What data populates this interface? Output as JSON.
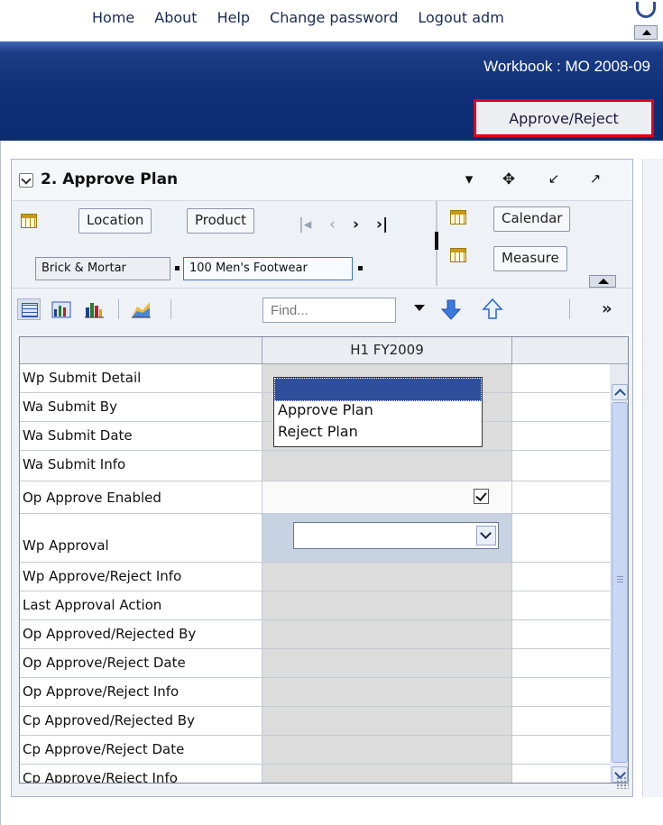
{
  "topnav": {
    "links": [
      {
        "label": "Home",
        "name": "nav-home"
      },
      {
        "label": "About",
        "name": "nav-about"
      },
      {
        "label": "Help",
        "name": "nav-help"
      },
      {
        "label": "Change password",
        "name": "nav-change-password"
      },
      {
        "label": "Logout adm",
        "name": "nav-logout"
      }
    ]
  },
  "header": {
    "workbook_title": "Workbook : MO 2008-09",
    "approve_reject_label": "Approve/Reject",
    "highlight_color": "#e3001b"
  },
  "panel": {
    "title": "2. Approve Plan",
    "icons": [
      "dropdown-icon",
      "move-icon",
      "minimize-icon",
      "maximize-icon"
    ]
  },
  "dimensions": {
    "left_buttons": [
      "Location",
      "Product"
    ],
    "right_buttons": [
      "Calendar",
      "Measure"
    ],
    "filters": [
      "Brick & Mortar",
      "100 Men's Footwear"
    ],
    "nav_arrows": [
      "first-icon",
      "prev-icon",
      "next-icon",
      "last-icon"
    ]
  },
  "toolbar": {
    "find_placeholder": "Find...",
    "icons": [
      "grid-view-icon",
      "chart-grid-icon",
      "bar-chart-icon",
      "area-chart-icon",
      "move-down-icon",
      "move-up-icon",
      "more-icon"
    ]
  },
  "grid": {
    "column_header": "H1 FY2009",
    "rows": [
      {
        "label": "Wp Submit Detail"
      },
      {
        "label": "Wa Submit By"
      },
      {
        "label": "Wa Submit Date"
      },
      {
        "label": "Wa Submit Info"
      },
      {
        "label": "Op Approve Enabled",
        "checked": true
      },
      {
        "label": "Wp Approval",
        "value": ""
      },
      {
        "label": "Wp Approve/Reject Info"
      },
      {
        "label": "Last Approval Action"
      },
      {
        "label": "Op Approved/Rejected By"
      },
      {
        "label": "Op Approve/Reject Date"
      },
      {
        "label": "Op Approve/Reject Info"
      },
      {
        "label": "Cp Approved/Rejected By"
      },
      {
        "label": "Cp Approve/Reject Date"
      },
      {
        "label": "Cp Approve/Reject Info"
      }
    ],
    "dropdown_options": [
      "",
      "Approve Plan",
      "Reject Plan"
    ]
  }
}
